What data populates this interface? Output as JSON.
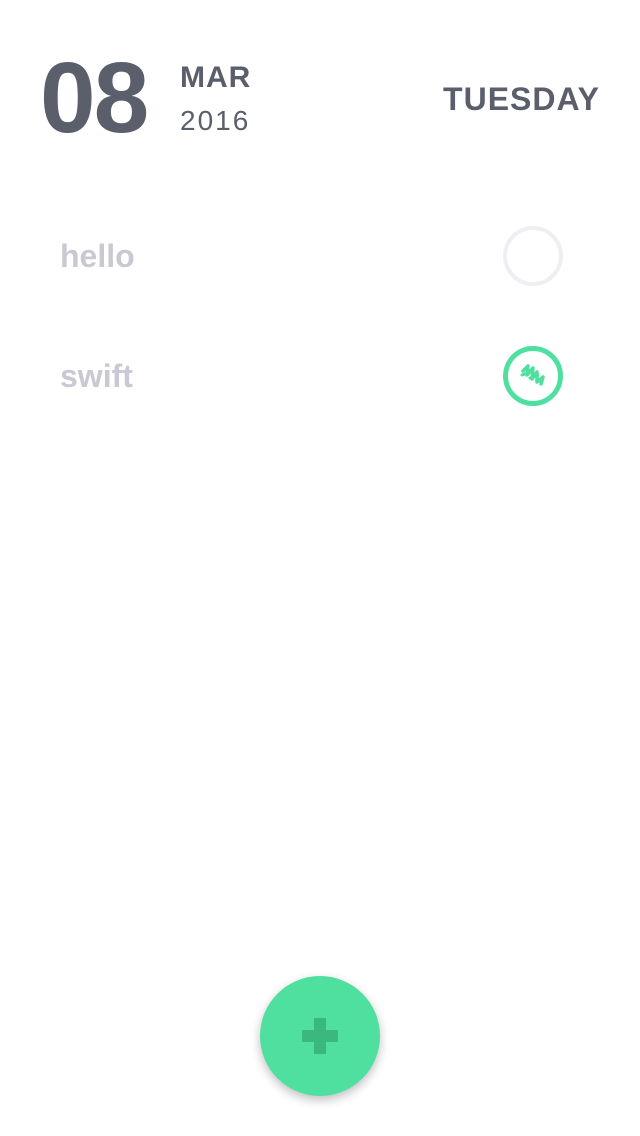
{
  "header": {
    "day": "08",
    "month": "MAR",
    "year": "2016",
    "weekday": "TUESDAY"
  },
  "tasks": [
    {
      "label": "hello",
      "done": false
    },
    {
      "label": "swift",
      "done": true
    }
  ],
  "fab": {
    "icon": "plus-icon"
  },
  "colors": {
    "text_dark": "#5b5e6b",
    "text_muted": "#c8c9d2",
    "accent": "#4fe09f",
    "circle_empty": "#eeeef3"
  }
}
